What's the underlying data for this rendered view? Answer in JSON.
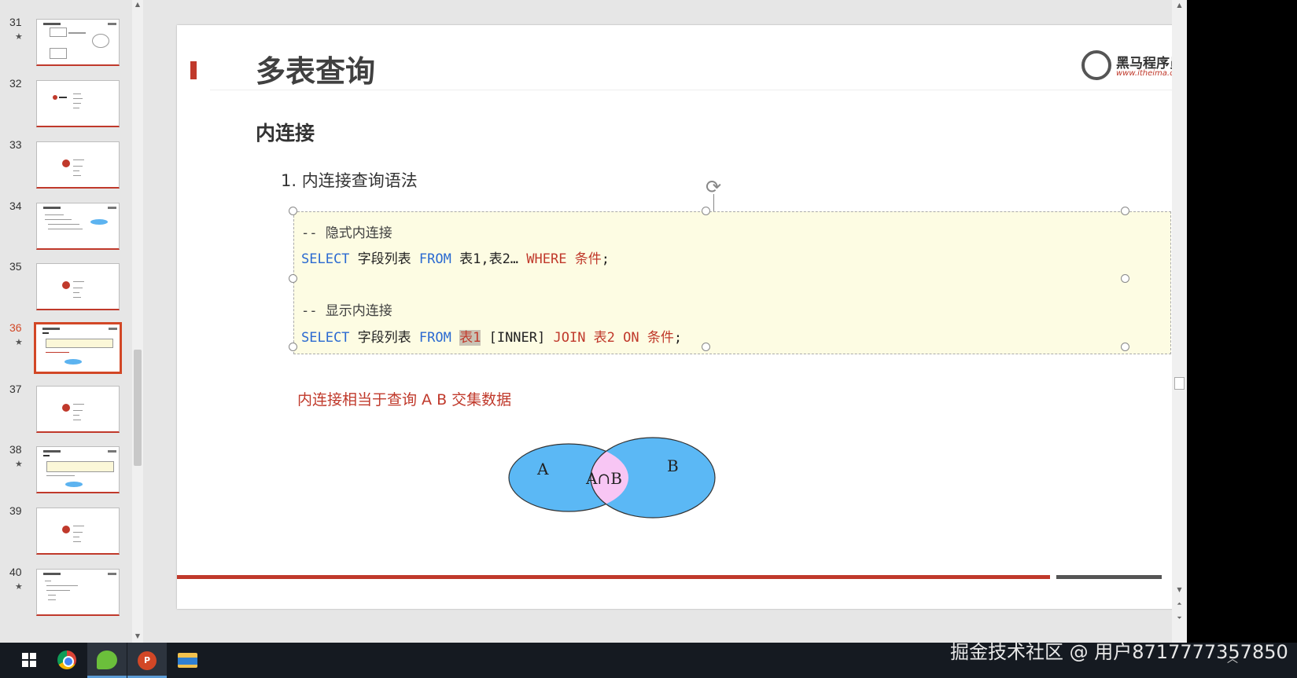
{
  "thumbnails": [
    {
      "num": "31",
      "star": "★",
      "kind": "diagram"
    },
    {
      "num": "32",
      "star": "",
      "kind": "list"
    },
    {
      "num": "33",
      "star": "",
      "kind": "section"
    },
    {
      "num": "34",
      "star": "",
      "kind": "text-oval"
    },
    {
      "num": "35",
      "star": "",
      "kind": "section"
    },
    {
      "num": "36",
      "star": "★",
      "kind": "code-oval"
    },
    {
      "num": "37",
      "star": "",
      "kind": "section"
    },
    {
      "num": "38",
      "star": "★",
      "kind": "code-oval"
    },
    {
      "num": "39",
      "star": "",
      "kind": "section"
    },
    {
      "num": "40",
      "star": "★",
      "kind": "text"
    }
  ],
  "slide": {
    "title": "多表查询",
    "logo_text": "黑马程序员",
    "logo_url": "www.itheima.com",
    "subheading": "内连接",
    "list_item": "1. 内连接查询语法",
    "code": {
      "line1_comment": "-- 隐式内连接",
      "line2": {
        "select": "SELECT",
        "fields": " 字段列表 ",
        "from": "FROM",
        "tables": " 表1,表2… ",
        "where": "WHERE",
        "cond": " 条件",
        "end": ";"
      },
      "line3_comment": "-- 显示内连接",
      "line4": {
        "select": "SELECT",
        "fields": " 字段列表 ",
        "from": "FROM",
        "sp": " ",
        "table1": "表1",
        "inner": " [INNER] ",
        "join": "JOIN",
        "table2": " 表2 ",
        "on": "ON",
        "cond": " 条件",
        "end": ";"
      }
    },
    "note": "内连接相当于查询 A B 交集数据",
    "venn": {
      "a": "A",
      "b": "B",
      "intersection": "A∩B",
      "fill_sets": "#5bb8f5",
      "fill_intersection": "#f8c6f4"
    }
  },
  "colors": {
    "accent": "#c0392b",
    "keyword": "#2b6ad1"
  },
  "taskbar": {
    "items": [
      "windows-start",
      "chrome",
      "app-leaf",
      "powerpoint",
      "file-explorer"
    ],
    "ppt_letter": "P"
  },
  "watermark": "掘金技术社区 @ 用户8717777357850"
}
